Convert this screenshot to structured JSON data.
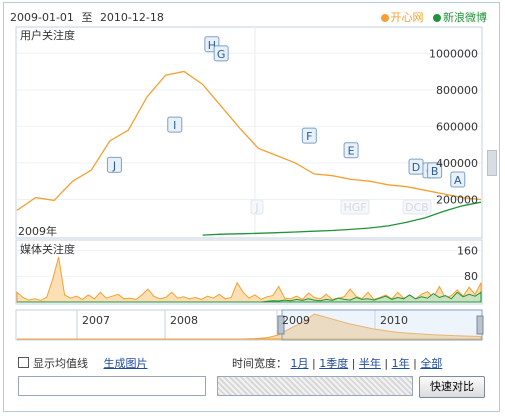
{
  "header": {
    "date_from": "2009-01-01",
    "date_sep": "至",
    "date_to": "2010-12-18"
  },
  "legend": [
    {
      "label": "开心网",
      "color": "#f5a030"
    },
    {
      "label": "新浪微博",
      "color": "#21933a"
    }
  ],
  "chart_data": [
    {
      "type": "line",
      "title": "用户关注度",
      "ylim": [
        0,
        1100000
      ],
      "yticks": [
        200000,
        400000,
        600000,
        800000,
        1000000
      ],
      "series": [
        {
          "name": "开心网",
          "color": "#f5a030",
          "x": [
            0,
            4,
            8,
            12,
            16,
            20,
            24,
            28,
            32,
            36,
            40,
            44,
            48,
            52,
            56,
            60,
            64,
            68,
            72,
            76,
            80,
            84,
            88,
            92,
            96,
            100
          ],
          "values": [
            140000,
            210000,
            195000,
            300000,
            360000,
            520000,
            580000,
            760000,
            880000,
            900000,
            830000,
            710000,
            590000,
            480000,
            440000,
            400000,
            340000,
            330000,
            310000,
            300000,
            280000,
            270000,
            250000,
            230000,
            210000,
            200000
          ]
        },
        {
          "name": "新浪微博",
          "color": "#21933a",
          "x": [
            0,
            4,
            8,
            12,
            16,
            20,
            24,
            28,
            32,
            36,
            40,
            44,
            48,
            52,
            56,
            60,
            64,
            68,
            72,
            76,
            80,
            84,
            88,
            92,
            96,
            100
          ],
          "values": [
            null,
            null,
            null,
            null,
            null,
            null,
            null,
            null,
            null,
            null,
            5000,
            10000,
            12000,
            15000,
            18000,
            22000,
            26000,
            30000,
            36000,
            44000,
            55000,
            75000,
            100000,
            135000,
            165000,
            185000
          ]
        }
      ],
      "events": [
        {
          "label": "J",
          "x": 21,
          "y": 310000
        },
        {
          "label": "I",
          "x": 34,
          "y": 530000
        },
        {
          "label": "H",
          "x": 42,
          "y": 970000
        },
        {
          "label": "G",
          "x": 44,
          "y": 920000
        },
        {
          "label": "F",
          "x": 63,
          "y": 470000
        },
        {
          "label": "E",
          "x": 72,
          "y": 390000
        },
        {
          "label": "D",
          "x": 86,
          "y": 300000
        },
        {
          "label": "C",
          "x": 89,
          "y": 280000
        },
        {
          "label": "B",
          "x": 90,
          "y": 280000
        },
        {
          "label": "A",
          "x": 95,
          "y": 230000
        }
      ],
      "ghost_events": [
        "J",
        "HGF",
        "E",
        "DCB"
      ]
    },
    {
      "type": "area",
      "title": "媒体关注度",
      "year_label": "2009年",
      "ylim": [
        0,
        180
      ],
      "yticks": [
        80,
        160
      ],
      "series": [
        {
          "name": "开心网",
          "color": "#f5a030",
          "values": [
            30,
            14,
            6,
            10,
            5,
            15,
            70,
            140,
            22,
            12,
            18,
            8,
            22,
            10,
            30,
            12,
            18,
            24,
            10,
            12,
            8,
            22,
            40,
            18,
            10,
            14,
            30,
            12,
            16,
            10,
            14,
            8,
            18,
            12,
            24,
            10,
            14,
            60,
            30,
            12,
            22,
            8,
            16,
            20,
            48,
            12,
            10,
            18,
            8,
            28,
            14,
            10,
            24,
            8,
            12,
            16,
            40,
            18,
            10,
            30,
            8,
            14,
            22,
            10,
            30,
            12,
            18,
            10,
            24,
            32,
            14,
            48,
            12,
            20,
            38,
            18,
            46,
            24,
            60
          ]
        },
        {
          "name": "新浪微博",
          "color": "#21933a",
          "values": [
            0,
            0,
            0,
            0,
            0,
            0,
            0,
            0,
            0,
            0,
            0,
            0,
            0,
            0,
            0,
            0,
            0,
            0,
            0,
            0,
            0,
            0,
            0,
            0,
            0,
            0,
            0,
            0,
            0,
            0,
            0,
            0,
            0,
            0,
            0,
            0,
            0,
            0,
            0,
            0,
            0,
            0,
            2,
            4,
            3,
            6,
            4,
            8,
            5,
            10,
            6,
            4,
            8,
            5,
            12,
            8,
            6,
            14,
            8,
            10,
            6,
            12,
            18,
            8,
            14,
            10,
            22,
            10,
            16,
            12,
            26,
            14,
            20,
            10,
            30,
            16,
            24,
            18,
            30
          ]
        }
      ]
    },
    {
      "type": "area",
      "title": "overview",
      "x_labels": [
        "2007",
        "2008",
        "2009",
        "2010"
      ],
      "series": [
        {
          "name": "开心网",
          "color": "#f5a030",
          "values": [
            0,
            0,
            0,
            0,
            0,
            0,
            0,
            0,
            0,
            0,
            0,
            0,
            0,
            0,
            0,
            0,
            0,
            0,
            0,
            0,
            1,
            3,
            10,
            26,
            40,
            60,
            52,
            44,
            36,
            30,
            24,
            20,
            16,
            14,
            12,
            10,
            9,
            8,
            7,
            6
          ]
        }
      ]
    }
  ],
  "controls": {
    "show_avg_label": "显示均值线",
    "gen_image_label": "生成图片",
    "time_width_label": "时间宽度：",
    "ranges": [
      "1月",
      "1季度",
      "半年",
      "1年",
      "全部"
    ],
    "compare_button": "快速对比"
  }
}
